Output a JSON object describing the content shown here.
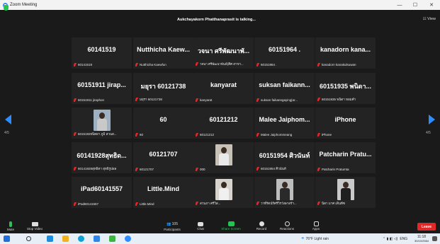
{
  "window": {
    "title": "Zoom Meeting",
    "minimize": "—",
    "maximize": "☐",
    "close": "✕"
  },
  "topbar": {
    "talking": "Aukchayakorn Phatthanaprasit is talking...",
    "view_label": "View"
  },
  "pager": {
    "left": "4/5",
    "right": "4/5"
  },
  "tiles": [
    {
      "big": "60141519",
      "small": "60141519",
      "photo": false
    },
    {
      "big": "Nutthicha  Kaew...",
      "small": "Nutthicha Kaewfun",
      "photo": false
    },
    {
      "big": "วจนา ศรีพัฒนาพั...",
      "small": "วจนา ศรีพัฒนาพันธ์(ศิศ สาขา...",
      "photo": false
    },
    {
      "big": "60151964 .",
      "small": "60151964 .",
      "photo": false
    },
    {
      "big": "kanadorn  kana...",
      "small": "kanadorn kanakulsuwan",
      "photo": false
    },
    {
      "big": "60151911  jirap...",
      "small": "60151911 jiraphon",
      "photo": false
    },
    {
      "big": "มยุรา 60121738",
      "small": "มยุรา 60121738",
      "photo": false
    },
    {
      "big": "kanyarat",
      "small": "kanyarat",
      "photo": false
    },
    {
      "big": "suksan  faikann...",
      "small": "suksan faikanngaying|ar...",
      "photo": false
    },
    {
      "big": "60151935 พนิดา...",
      "small": "60151935 พนิดา หอมคำ",
      "photo": false
    },
    {
      "big": "",
      "small": "60151929นิตยา ภูมิ สวนส...",
      "photo": true,
      "shirt": "#c9c9c9",
      "bg": "#9fb0c0"
    },
    {
      "big": "60",
      "small": "60",
      "photo": false
    },
    {
      "big": "60121212",
      "small": "60121212",
      "photo": false
    },
    {
      "big": "Malee  Jaiphom...",
      "small": "Malee Jaiphommeang",
      "photo": false
    },
    {
      "big": "iPhone",
      "small": "iPhone",
      "photo": false
    },
    {
      "big": "60141928สุทธิด...",
      "small": "60141928สุทธิดา สุทธิรูปผล",
      "photo": false
    },
    {
      "big": "60121707",
      "small": "60121707",
      "photo": false
    },
    {
      "big": "",
      "small": "000",
      "photo": true,
      "shirt": "#e9e9e9",
      "bg": "#c7c1b8"
    },
    {
      "big": "60151954 ศิวนันท์",
      "small": "60151954 ศิวนันท์",
      "photo": false
    },
    {
      "big": "Patcharin  Pratu...",
      "small": "Patcharin Pratumta",
      "photo": false
    },
    {
      "big": "iPad60141557",
      "small": "iPad60141557",
      "photo": false
    },
    {
      "big": "Little.Mind",
      "small": "Little.Mind",
      "photo": false
    },
    {
      "big": "",
      "small": "สวนภา ศรีวิส...",
      "photo": true,
      "shirt": "#f0f0f0",
      "bg": "#d8d3cc"
    },
    {
      "big": "",
      "small": "วาที่รัตน์ร์ศรีวิรวังษาสร้า...",
      "photo": true,
      "shirt": "#2a2a2a",
      "bg": "#bdbdbd"
    },
    {
      "big": "",
      "small": "นิดา มาศ เดินพีซ",
      "photo": true,
      "shirt": "#1f1f1f",
      "bg": "#c9c9c9"
    }
  ],
  "toolbar": {
    "mute": "Mute",
    "video": "Stop Video",
    "participants": "Participants",
    "participants_count": "105",
    "chat": "Chat",
    "share": "Share Screen",
    "record": "Record",
    "reactions": "Reactions",
    "apps": "Apps",
    "leave": "Leave"
  },
  "taskbar": {
    "weather": "76°F  Light rain",
    "lang": "ENG",
    "time": "11:18",
    "date": "30/10/2564"
  },
  "colors": {
    "accent": "#2d8cff",
    "share": "#23c552",
    "leave": "#e02828",
    "mic_muted": "#e02828"
  }
}
